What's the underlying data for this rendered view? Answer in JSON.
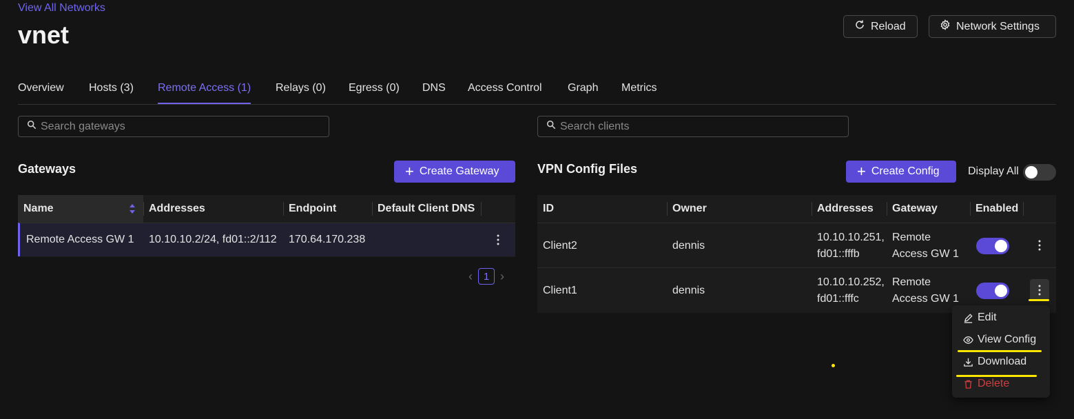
{
  "header": {
    "back_link": "View All Networks",
    "title": "vnet",
    "reload_label": "Reload",
    "settings_label": "Network Settings"
  },
  "tabs": [
    {
      "label": "Overview"
    },
    {
      "label": "Hosts (3)"
    },
    {
      "label": "Remote Access (1)",
      "active": true
    },
    {
      "label": "Relays (0)"
    },
    {
      "label": "Egress (0)"
    },
    {
      "label": "DNS"
    },
    {
      "label": "Access Control"
    },
    {
      "label": "Graph"
    },
    {
      "label": "Metrics"
    }
  ],
  "gateways": {
    "search_placeholder": "Search gateways",
    "title": "Gateways",
    "create_label": "Create Gateway",
    "columns": [
      "Name",
      "Addresses",
      "Endpoint",
      "Default Client DNS"
    ],
    "rows": [
      {
        "name": "Remote Access GW 1",
        "addresses": "10.10.10.2/24, fd01::2/112",
        "endpoint": "170.64.170.238",
        "dns": ""
      }
    ],
    "page": "1"
  },
  "configs": {
    "search_placeholder": "Search clients",
    "title": "VPN Config Files",
    "create_label": "Create Config",
    "display_all_label": "Display All",
    "display_all_on": false,
    "columns": [
      "ID",
      "Owner",
      "Addresses",
      "Gateway",
      "Enabled"
    ],
    "rows": [
      {
        "id": "Client2",
        "owner": "dennis",
        "addr1": "10.10.10.251,",
        "addr2": "fd01::fffb",
        "gw1": "Remote",
        "gw2": "Access GW 1",
        "enabled": true
      },
      {
        "id": "Client1",
        "owner": "dennis",
        "addr1": "10.10.10.252,",
        "addr2": "fd01::fffc",
        "gw1": "Remote",
        "gw2": "Access GW 1",
        "enabled": true
      }
    ]
  },
  "row_menu": {
    "items": [
      {
        "label": "Edit",
        "icon": "pencil-icon"
      },
      {
        "label": "View Config",
        "icon": "eye-icon"
      },
      {
        "label": "Download",
        "icon": "download-icon"
      },
      {
        "label": "Delete",
        "icon": "trash-icon"
      }
    ]
  },
  "colors": {
    "accent": "#5b4ad8",
    "link": "#7065f0",
    "danger": "#d23d3d",
    "highlight": "#ffe600",
    "background": "#141414"
  }
}
